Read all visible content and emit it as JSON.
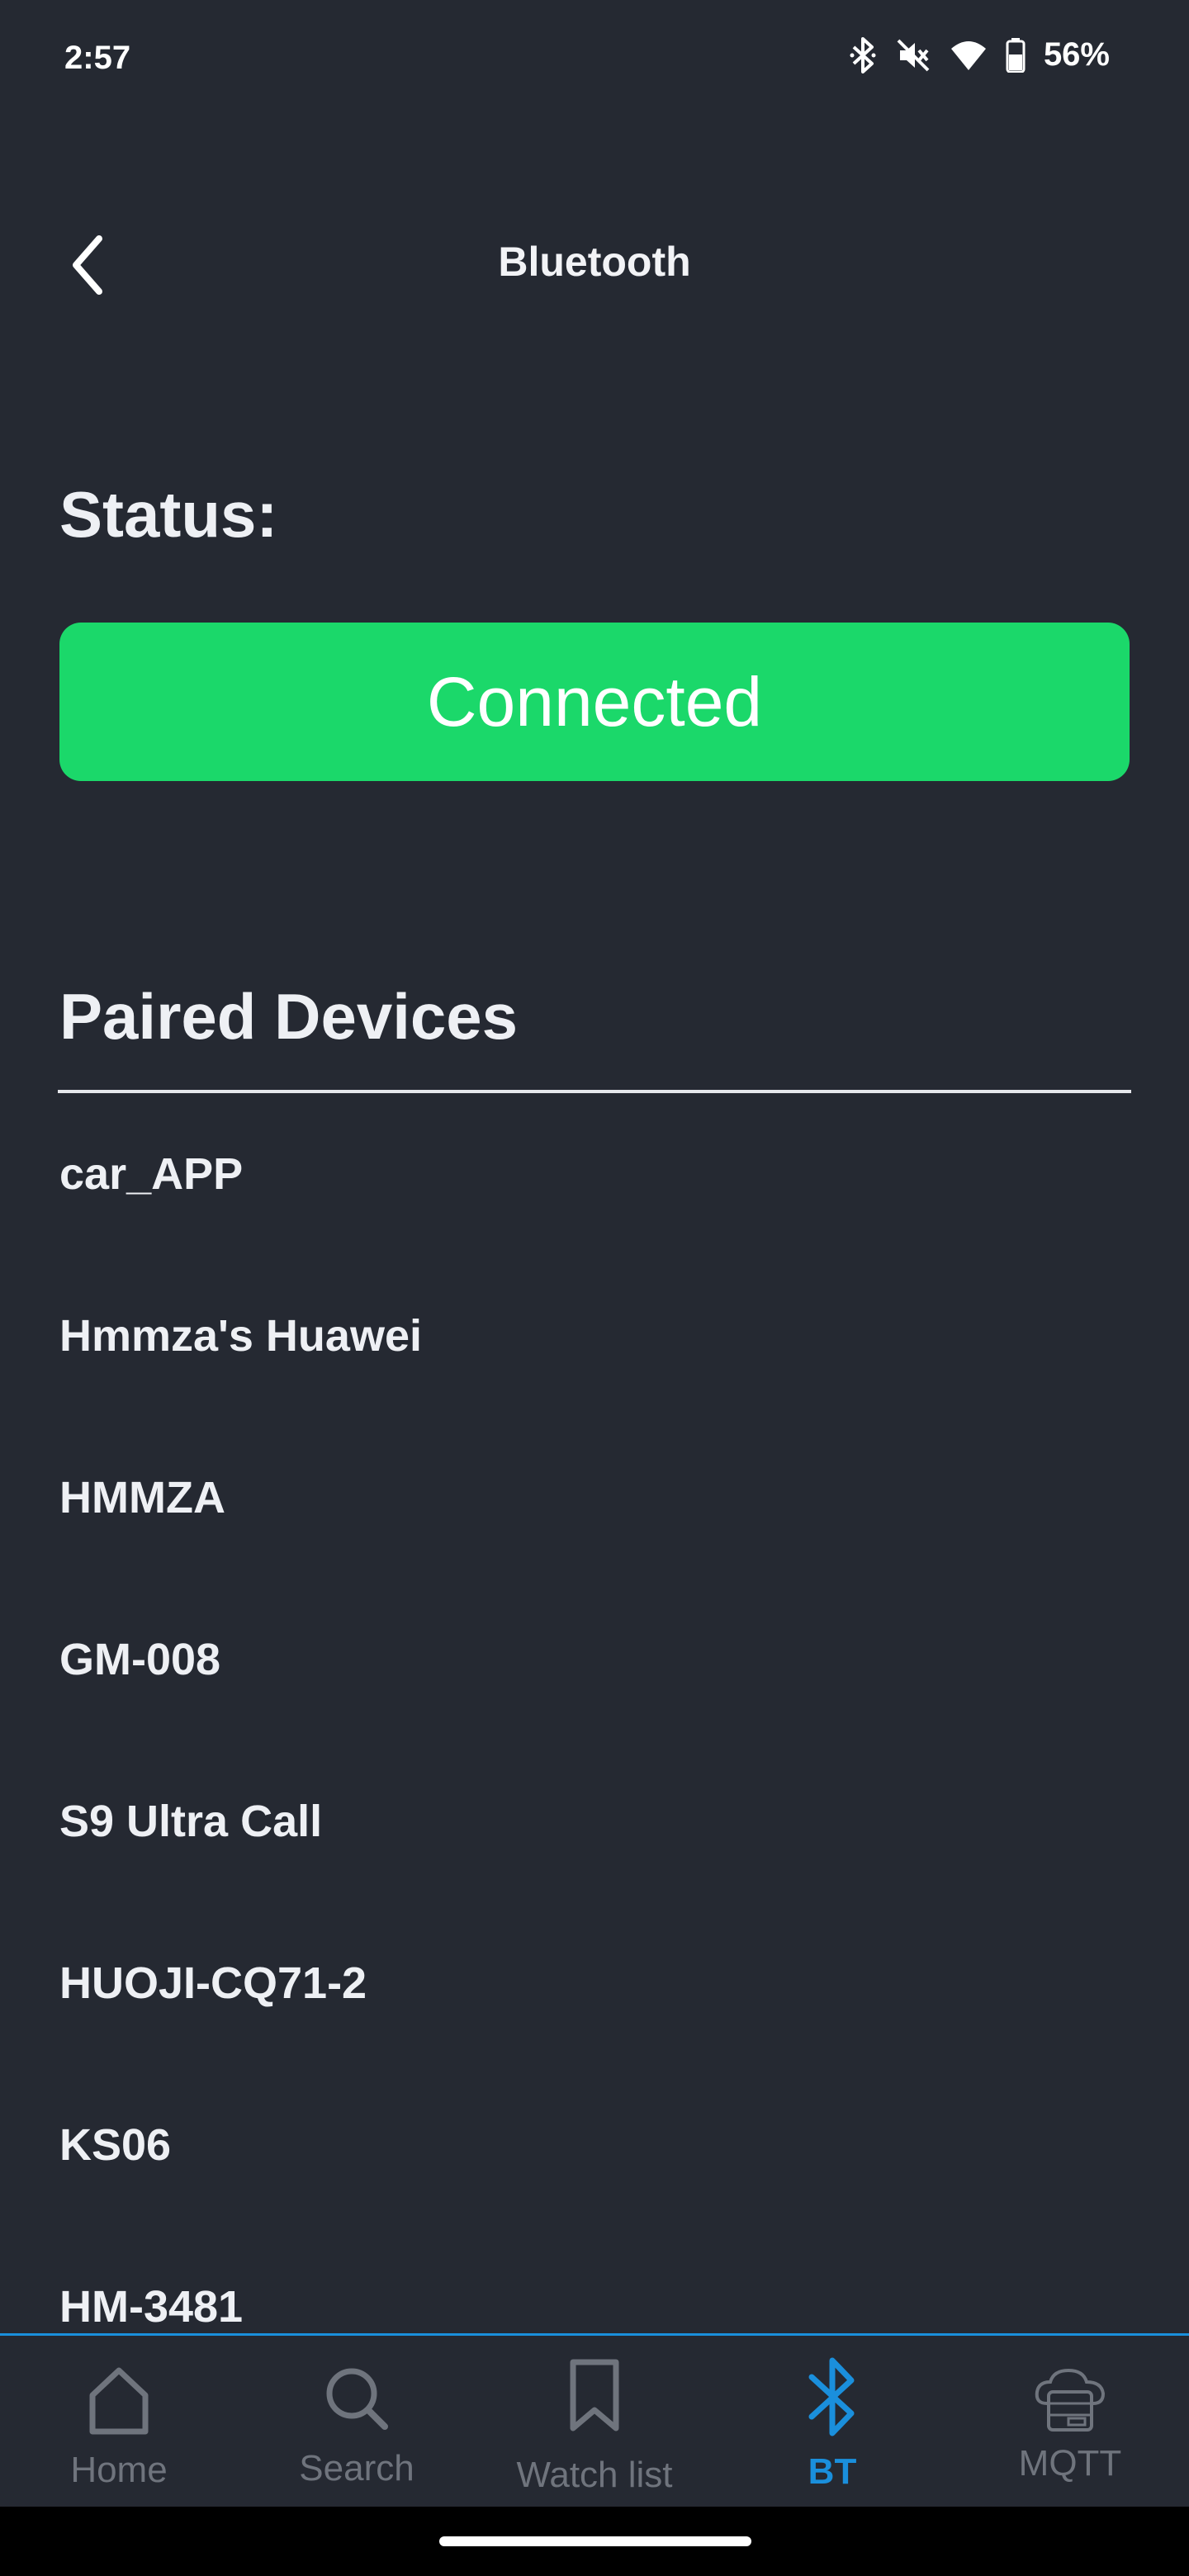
{
  "status_bar": {
    "time": "2:57",
    "battery": "56%"
  },
  "header": {
    "title": "Bluetooth"
  },
  "status": {
    "label": "Status:",
    "state": "Connected",
    "state_color": "#1bd86a"
  },
  "paired": {
    "title": "Paired Devices",
    "devices": [
      "car_APP",
      "Hmmza's Huawei",
      "HMMZA",
      "GM-008",
      "S9 Ultra Call",
      "HUOJI-CQ71-2",
      "KS06",
      "HM-3481"
    ]
  },
  "nav": {
    "items": [
      {
        "label": "Home",
        "icon": "home-icon"
      },
      {
        "label": "Search",
        "icon": "search-icon"
      },
      {
        "label": "Watch list",
        "icon": "bookmark-icon"
      },
      {
        "label": "BT",
        "icon": "bluetooth-icon"
      },
      {
        "label": "MQTT",
        "icon": "cloud-server-icon"
      }
    ],
    "active": "BT",
    "active_color": "#1a8fdc",
    "inactive_color": "#6f747d"
  }
}
